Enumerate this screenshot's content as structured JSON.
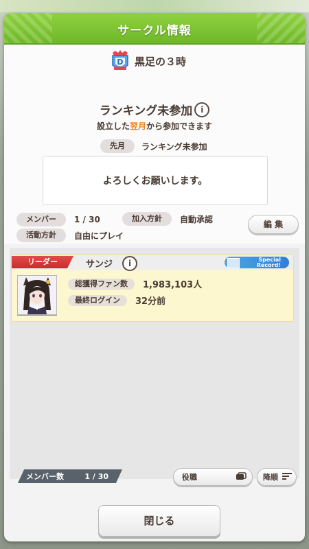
{
  "dialog": {
    "title": "サークル情報"
  },
  "circle": {
    "name": "黒足の３時",
    "emblem_letter": "D",
    "ranking_status": "ランキング未参加",
    "ranking_note_prefix": "設立した",
    "ranking_note_highlight": "翌月",
    "ranking_note_suffix": "から参加できます",
    "last_month_label": "先月",
    "last_month_value": "ランキング未参加",
    "comment": "よろしくお願いします。",
    "members_label": "メンバー",
    "members_value": "1 / 30",
    "join_policy_label": "加入方針",
    "join_policy_value": "自動承認",
    "activity_policy_label": "活動方針",
    "activity_policy_value": "自由にプレイ",
    "edit_label": "編 集"
  },
  "member_list": {
    "members": [
      {
        "role": "リーダー",
        "name": "サンジ",
        "badge_line1": "Special",
        "badge_line2": "Record!",
        "fans_label": "総獲得ファン数",
        "fans_value": "1,983,103人",
        "last_login_label": "最終ログイン",
        "last_login_value": "32分前"
      }
    ],
    "count_label": "メンバー数",
    "count_value": "1 / 30",
    "sort_role_label": "役職",
    "sort_order_label": "降順"
  },
  "close_label": "閉じる",
  "colors": {
    "header_green": "#7cc234",
    "leader_red": "#d63a3a",
    "highlight_orange": "#e8862a",
    "text_brown": "#4a3c34"
  }
}
